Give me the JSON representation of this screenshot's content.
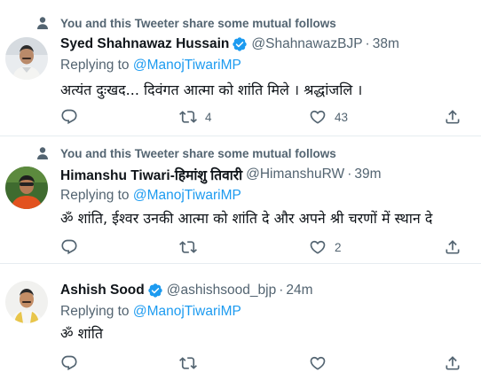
{
  "tweets": [
    {
      "context": "You and this Tweeter share some mutual follows",
      "name": "Syed Shahnawaz Hussain",
      "verified": true,
      "handle": "@ShahnawazBJP",
      "separator": "·",
      "time": "38m",
      "replying_prefix": "Replying to",
      "replying_mention": "@ManojTiwariMP",
      "text": "अत्यंत दुःखद... दिवंगत आत्मा को शांति मिले । श्रद्धांजलि ।",
      "reply_count": "",
      "retweet_count": "4",
      "like_count": "43"
    },
    {
      "context": "You and this Tweeter share some mutual follows",
      "name": "Himanshu Tiwari-हिमांशु तिवारी",
      "verified": false,
      "handle": "@HimanshuRW",
      "separator": "·",
      "time": "39m",
      "replying_prefix": "Replying to",
      "replying_mention": "@ManojTiwariMP",
      "text": "ॐ शांति, ईश्वर उनकी आत्मा को शांति दे और अपने श्री चरणों में स्थान दे",
      "reply_count": "",
      "retweet_count": "",
      "like_count": "2"
    },
    {
      "context": "",
      "name": "Ashish Sood",
      "verified": true,
      "handle": "@ashishsood_bjp",
      "separator": "·",
      "time": "24m",
      "replying_prefix": "Replying to",
      "replying_mention": "@ManojTiwariMP",
      "text": "ॐ शांति",
      "reply_count": "",
      "retweet_count": "",
      "like_count": ""
    }
  ],
  "colors": {
    "text_primary": "#0f1419",
    "text_secondary": "#536471",
    "accent_blue": "#1d9bf0",
    "divider": "#e6ecf0"
  },
  "icons": [
    "person-icon",
    "verified-badge-icon",
    "reply-icon",
    "retweet-icon",
    "like-icon",
    "share-icon"
  ]
}
